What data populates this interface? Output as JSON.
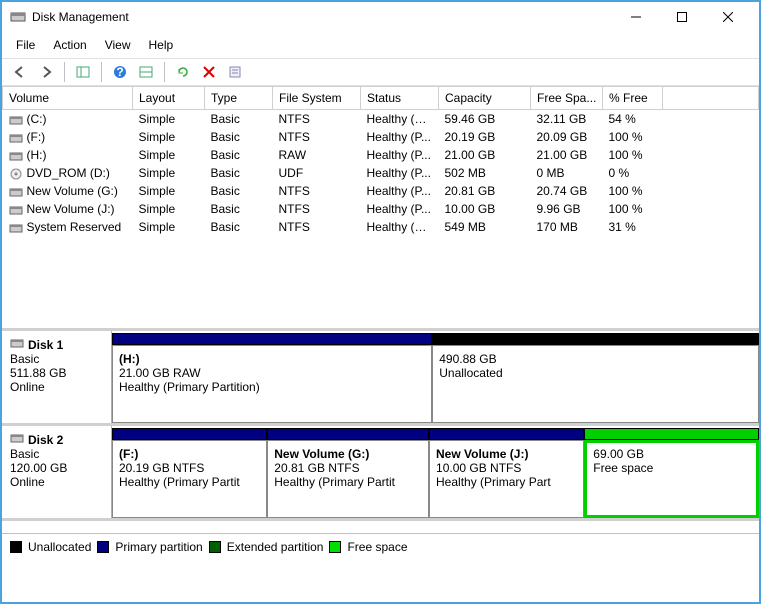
{
  "window": {
    "title": "Disk Management"
  },
  "menu": {
    "file": "File",
    "action": "Action",
    "view": "View",
    "help": "Help"
  },
  "columns": {
    "volume": "Volume",
    "layout": "Layout",
    "type": "Type",
    "fs": "File System",
    "status": "Status",
    "capacity": "Capacity",
    "free": "Free Spa...",
    "pct": "% Free"
  },
  "volumes": [
    {
      "name": "(C:)",
      "layout": "Simple",
      "type": "Basic",
      "fs": "NTFS",
      "status": "Healthy (B...",
      "capacity": "59.46 GB",
      "free": "32.11 GB",
      "pct": "54 %",
      "icon": "drive"
    },
    {
      "name": "(F:)",
      "layout": "Simple",
      "type": "Basic",
      "fs": "NTFS",
      "status": "Healthy (P...",
      "capacity": "20.19 GB",
      "free": "20.09 GB",
      "pct": "100 %",
      "icon": "drive"
    },
    {
      "name": "(H:)",
      "layout": "Simple",
      "type": "Basic",
      "fs": "RAW",
      "status": "Healthy (P...",
      "capacity": "21.00 GB",
      "free": "21.00 GB",
      "pct": "100 %",
      "icon": "drive"
    },
    {
      "name": "DVD_ROM (D:)",
      "layout": "Simple",
      "type": "Basic",
      "fs": "UDF",
      "status": "Healthy (P...",
      "capacity": "502 MB",
      "free": "0 MB",
      "pct": "0 %",
      "icon": "disc"
    },
    {
      "name": "New Volume (G:)",
      "layout": "Simple",
      "type": "Basic",
      "fs": "NTFS",
      "status": "Healthy (P...",
      "capacity": "20.81 GB",
      "free": "20.74 GB",
      "pct": "100 %",
      "icon": "drive"
    },
    {
      "name": "New Volume (J:)",
      "layout": "Simple",
      "type": "Basic",
      "fs": "NTFS",
      "status": "Healthy (P...",
      "capacity": "10.00 GB",
      "free": "9.96 GB",
      "pct": "100 %",
      "icon": "drive"
    },
    {
      "name": "System Reserved",
      "layout": "Simple",
      "type": "Basic",
      "fs": "NTFS",
      "status": "Healthy (S...",
      "capacity": "549 MB",
      "free": "170 MB",
      "pct": "31 %",
      "icon": "drive"
    }
  ],
  "disks": [
    {
      "name": "Disk 1",
      "kind": "Basic",
      "size": "511.88 GB",
      "state": "Online",
      "strips": [
        {
          "color": "#000080",
          "width": "49.5%"
        },
        {
          "color": "#000000",
          "width": "50.5%"
        }
      ],
      "parts": [
        {
          "title": "(H:)",
          "line1": "21.00 GB RAW",
          "line2": "Healthy (Primary Partition)",
          "width": "49.5%",
          "thick": false
        },
        {
          "title": "",
          "line1": "490.88 GB",
          "line2": "Unallocated",
          "width": "50.5%",
          "thick": false
        }
      ]
    },
    {
      "name": "Disk 2",
      "kind": "Basic",
      "size": "120.00 GB",
      "state": "Online",
      "strips": [
        {
          "color": "#000080",
          "width": "24%"
        },
        {
          "color": "#000080",
          "width": "25%"
        },
        {
          "color": "#000080",
          "width": "24%"
        },
        {
          "color": "#00d000",
          "width": "27%"
        }
      ],
      "parts": [
        {
          "title": "(F:)",
          "line1": "20.19 GB NTFS",
          "line2": "Healthy (Primary Partit",
          "width": "24%",
          "thick": false
        },
        {
          "title": "New Volume  (G:)",
          "line1": "20.81 GB NTFS",
          "line2": "Healthy (Primary Partit",
          "width": "25%",
          "thick": false
        },
        {
          "title": "New Volume  (J:)",
          "line1": "10.00 GB NTFS",
          "line2": "Healthy (Primary Part",
          "width": "24%",
          "thick": false
        },
        {
          "title": "",
          "line1": "69.00 GB",
          "line2": "Free space",
          "width": "27%",
          "thick": true
        }
      ]
    }
  ],
  "legend": {
    "unalloc": "Unallocated",
    "primary": "Primary partition",
    "extended": "Extended partition",
    "free": "Free space"
  },
  "colors": {
    "unalloc": "#000000",
    "primary": "#000080",
    "extended": "#006000",
    "free": "#00e000"
  }
}
